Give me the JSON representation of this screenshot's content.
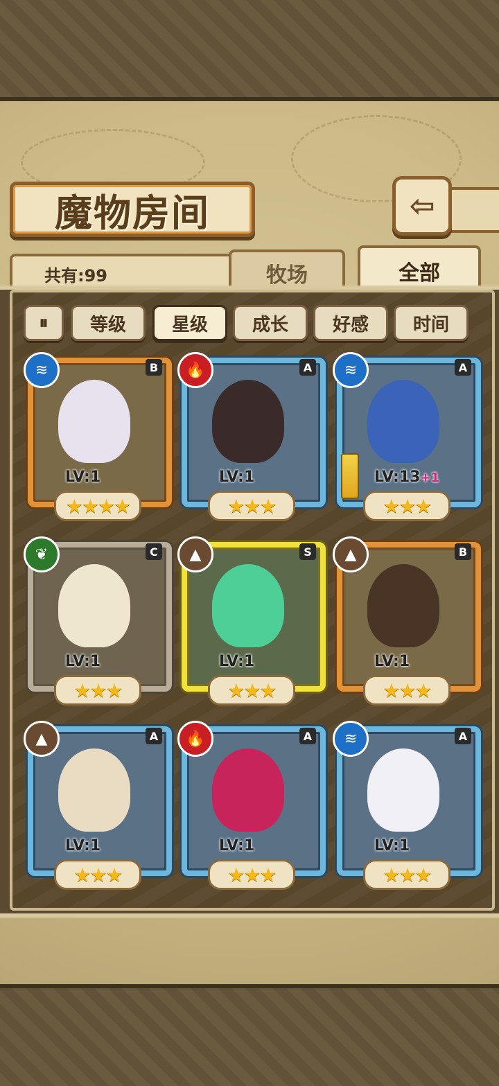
{
  "title": "魔物房间",
  "back_button_icon": "back-arrow-icon",
  "count_label": "共有:99",
  "tabs": [
    {
      "label": "牧场",
      "active": false
    },
    {
      "label": "全部",
      "active": true
    }
  ],
  "filters": [
    {
      "label": "等级",
      "active": false
    },
    {
      "label": "星级",
      "active": true
    },
    {
      "label": "成长",
      "active": false
    },
    {
      "label": "好感",
      "active": false
    },
    {
      "label": "时间",
      "active": false
    }
  ],
  "filter_toggle_icon": "sort-toggle-icon",
  "monsters": [
    {
      "element": "water",
      "rank": "B",
      "level": "LV:1",
      "bonus": "",
      "stars": 4,
      "frame": "orange"
    },
    {
      "element": "fire",
      "rank": "A",
      "level": "LV:1",
      "bonus": "",
      "stars": 3,
      "frame": "blue"
    },
    {
      "element": "water",
      "rank": "A",
      "level": "LV:13",
      "bonus": "+1",
      "stars": 3,
      "frame": "blue"
    },
    {
      "element": "wood",
      "rank": "C",
      "level": "LV:1",
      "bonus": "",
      "stars": 3,
      "frame": "gray"
    },
    {
      "element": "earth",
      "rank": "S",
      "level": "LV:1",
      "bonus": "",
      "stars": 3,
      "frame": "yellow"
    },
    {
      "element": "earth",
      "rank": "B",
      "level": "LV:1",
      "bonus": "",
      "stars": 3,
      "frame": "orange"
    },
    {
      "element": "earth",
      "rank": "A",
      "level": "LV:1",
      "bonus": "",
      "stars": 3,
      "frame": "blue"
    },
    {
      "element": "fire",
      "rank": "A",
      "level": "LV:1",
      "bonus": "",
      "stars": 3,
      "frame": "blue"
    },
    {
      "element": "water",
      "rank": "A",
      "level": "LV:1",
      "bonus": "",
      "stars": 3,
      "frame": "blue"
    }
  ],
  "colors": {
    "water": "#1e6fc6",
    "fire": "#c81e24",
    "wood": "#2e7a2c",
    "earth": "#6b4a32",
    "star": "#f5b81a"
  }
}
